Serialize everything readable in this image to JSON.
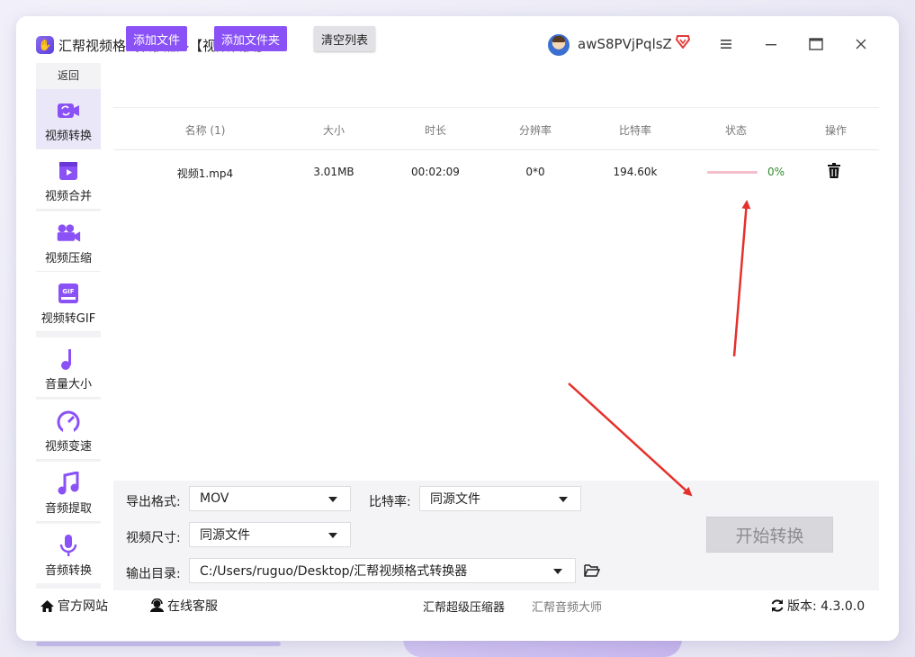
{
  "window": {
    "title": "汇帮视频格式转换器   -【视频转换】",
    "username": "awS8PVjPqlsZ",
    "controls": [
      "menu-icon",
      "minimize-icon",
      "maximize-icon",
      "close-icon"
    ]
  },
  "sidebar": {
    "back_label": "返回",
    "items": [
      {
        "label": "视频转换",
        "icon": "video-convert-icon",
        "active": true
      },
      {
        "label": "视频合并",
        "icon": "video-merge-icon",
        "active": false
      },
      {
        "label": "视频压缩",
        "icon": "video-compress-icon",
        "active": false
      },
      {
        "label": "视频转GIF",
        "icon": "gif-icon",
        "active": false
      },
      {
        "label": "音量大小",
        "icon": "music-note-icon",
        "active": false
      },
      {
        "label": "视频变速",
        "icon": "speedometer-icon",
        "active": false
      },
      {
        "label": "音频提取",
        "icon": "audio-extract-icon",
        "active": false
      },
      {
        "label": "音频转换",
        "icon": "microphone-icon",
        "active": false
      }
    ]
  },
  "toolbar": {
    "add_file": "添加文件",
    "add_folder": "添加文件夹",
    "clear_list": "清空列表"
  },
  "table": {
    "columns": [
      "名称 (1)",
      "大小",
      "时长",
      "分辨率",
      "比特率",
      "状态",
      "操作"
    ],
    "rows": [
      {
        "name": "视频1.mp4",
        "size": "3.01MB",
        "duration": "00:02:09",
        "resolution": "0*0",
        "bitrate": "194.60k",
        "status_pct": "0%",
        "progress": 0
      }
    ]
  },
  "settings": {
    "format_label": "导出格式:",
    "format_value": "MOV",
    "bitrate_label": "比特率:",
    "bitrate_value": "同源文件",
    "size_label": "视频尺寸:",
    "size_value": "同源文件",
    "output_label": "输出目录:",
    "output_value": "C:/Users/ruguo/Desktop/汇帮视频格式转换器",
    "start_button": "开始转换"
  },
  "footer": {
    "website": "官方网站",
    "support": "在线客服",
    "link1": "汇帮超级压缩器",
    "link2": "汇帮音频大师",
    "version_label": "版本: 4.3.0.0"
  },
  "colors": {
    "accent": "#8a52f6",
    "progress_track": "#f2bfcb",
    "percent": "#2e8b2e",
    "arrow": "#e5312b"
  }
}
